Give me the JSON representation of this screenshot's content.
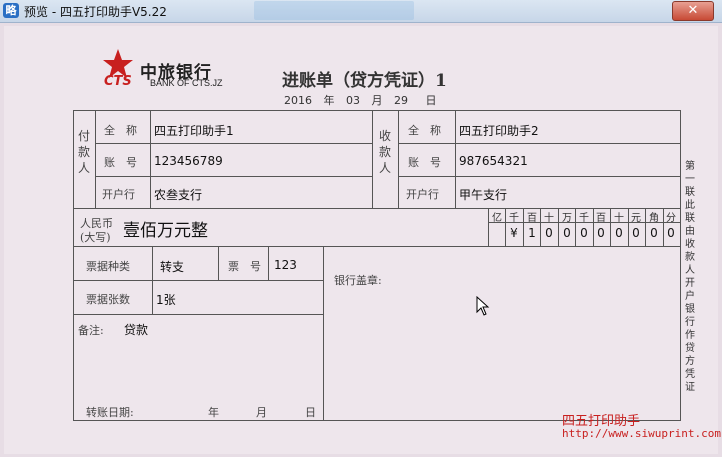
{
  "window": {
    "title": "预览 - 四五打印助手V5.22",
    "close": "✕"
  },
  "bank": {
    "name_cn": "中旅银行",
    "name_en": "BANK OF CTS.JZ",
    "logo_text": "CTS"
  },
  "doc": {
    "title": "进账单（贷方凭证）1"
  },
  "date": {
    "year": "2016",
    "year_unit": "年",
    "month": "03",
    "month_unit": "月",
    "day": "29",
    "day_unit": "日"
  },
  "payer": {
    "group_label": "付款人",
    "name_label": "全　称",
    "name": "四五打印助手1",
    "account_label": "账　号",
    "account": "123456789",
    "bank_label": "开户行",
    "bank": "农叁支行"
  },
  "payee": {
    "group_label": "收款人",
    "name_label": "全　称",
    "name": "四五打印助手2",
    "account_label": "账　号",
    "account": "987654321",
    "bank_label": "开户行",
    "bank": "甲午支行"
  },
  "amount": {
    "label_line1": "人民币",
    "label_line2": "(大写)",
    "words": "壹佰万元整",
    "digit_headers": [
      "亿",
      "千",
      "百",
      "十",
      "万",
      "千",
      "百",
      "十",
      "元",
      "角",
      "分"
    ],
    "digits": [
      "",
      "¥",
      "1",
      "0",
      "0",
      "0",
      "0",
      "0",
      "0",
      "0",
      "0"
    ]
  },
  "ticket": {
    "type_label": "票据种类",
    "type": "转支",
    "number_label": "票　号",
    "number": "123",
    "count_label": "票据张数",
    "count": "1张",
    "remark_label": "备注:",
    "remark": "贷款",
    "transfer_date_label": "转账日期:",
    "year_unit": "年",
    "month_unit": "月",
    "day_unit": "日"
  },
  "bank_seal_label": "银行盖章:",
  "side_note": "第一联 此联由收款人开户银行作贷方凭证",
  "footer": {
    "brand": "四五打印助手",
    "url": "http://www.siwuprint.com"
  },
  "colors": {
    "paper": "#eee6ec",
    "brand_red": "#c8201f",
    "line": "#555555"
  }
}
